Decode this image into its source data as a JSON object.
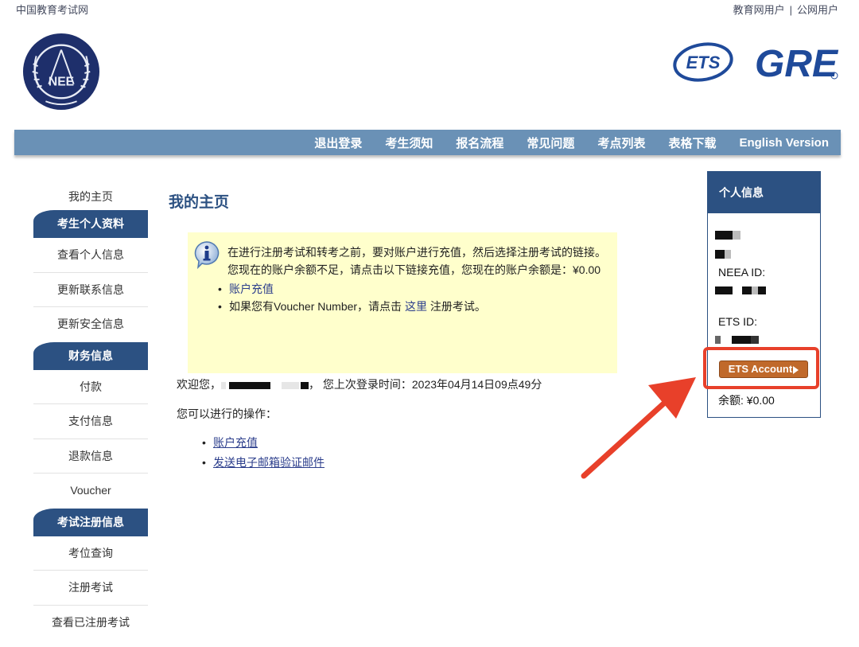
{
  "header": {
    "site_name": "中国教育考试网",
    "user_links": [
      "教育网用户",
      "公网用户"
    ],
    "separator": "|",
    "neea_logo_text": "NEE",
    "ets_logo_text": "ETS",
    "gre_logo_text": "GRE"
  },
  "navbar": {
    "items": [
      "退出登录",
      "考生须知",
      "报名流程",
      "常见问题",
      "考点列表",
      "表格下载",
      "English Version"
    ],
    "color": "#6a91b6"
  },
  "sidebar": {
    "home": "我的主页",
    "sections": [
      {
        "title": "考生个人资料",
        "items": [
          "查看个人信息",
          "更新联系信息",
          "更新安全信息"
        ]
      },
      {
        "title": "财务信息",
        "items": [
          "付款",
          "支付信息",
          "退款信息",
          "Voucher"
        ]
      },
      {
        "title": "考试注册信息",
        "items": [
          "考位查询",
          "注册考试",
          "查看已注册考试"
        ]
      }
    ],
    "head_color": "#2c5182"
  },
  "main": {
    "title": "我的主页",
    "notice": {
      "icon": "info-icon",
      "text": "在进行注册考试和转考之前，要对账户进行充值，然后选择注册考试的链接。您现在的账户余额不足，请点击以下链接充值，您现在的账户余额是：¥0.00",
      "bullet1_link": "账户充值",
      "bullet2_prefix": "如果您有Voucher Number，请点击 ",
      "bullet2_link": "这里",
      "bullet2_suffix": " 注册考试。",
      "background": "#ffffcc"
    },
    "welcome_prefix": "欢迎您，",
    "welcome_suffix": "，  您上次登录时间：2023年04月14日09点49分",
    "ops_label": "您可以进行的操作：",
    "ops_links": [
      "账户充值",
      "发送电子邮箱验证邮件"
    ]
  },
  "profile": {
    "title": "个人信息",
    "neea_id_label": "NEEA ID:",
    "ets_id_label": "ETS ID:",
    "ets_account_button": "ETS Account",
    "balance": "余额: ¥0.00",
    "highlight_color": "#e8402a"
  }
}
